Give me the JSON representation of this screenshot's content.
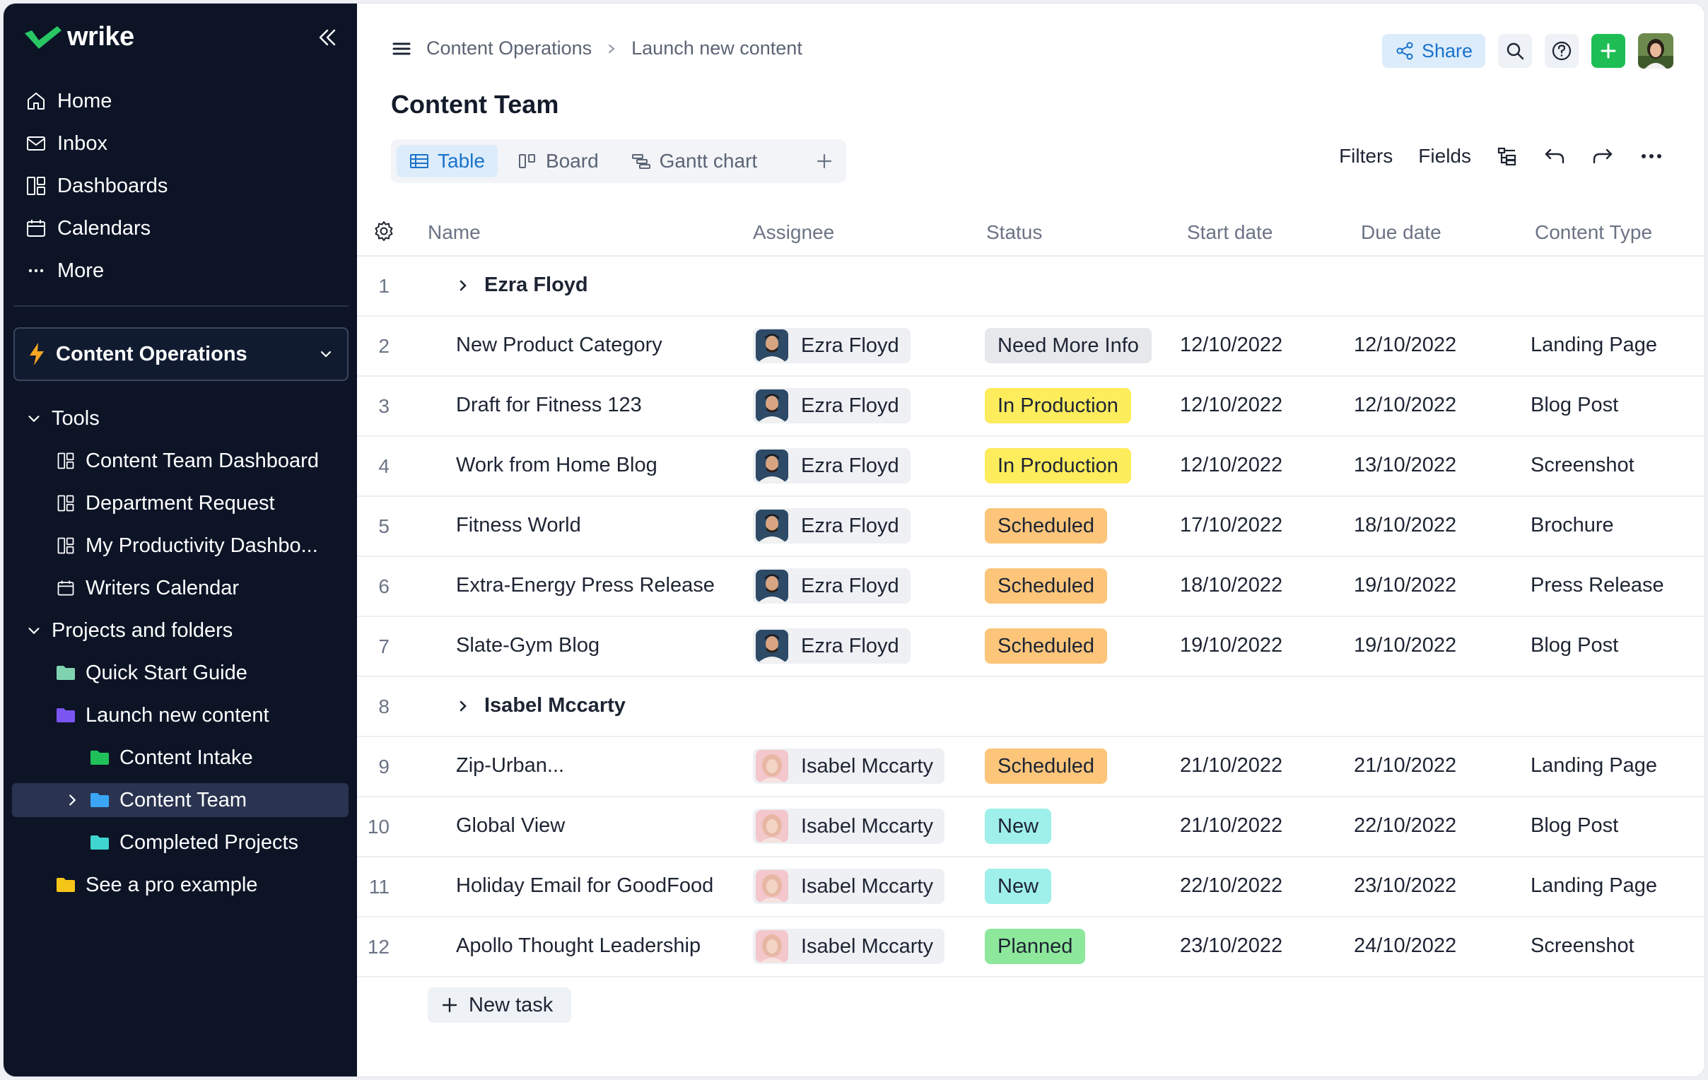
{
  "app": {
    "logo_text": "wrike"
  },
  "sidebar": {
    "nav": [
      {
        "label": "Home",
        "icon": "home-icon"
      },
      {
        "label": "Inbox",
        "icon": "inbox-icon"
      },
      {
        "label": "Dashboards",
        "icon": "dashboards-icon"
      },
      {
        "label": "Calendars",
        "icon": "calendar-icon"
      },
      {
        "label": "More",
        "icon": "more-icon"
      }
    ],
    "space": "Content Operations",
    "tree": {
      "tools": "Tools",
      "tool_items": [
        "Content Team Dashboard",
        "Department Request",
        "My Productivity Dashbo...",
        "Writers Calendar"
      ],
      "projects": "Projects and folders",
      "folders": [
        "Quick Start Guide",
        "Launch new content",
        "Content Intake",
        "Content Team",
        "Completed Projects",
        "See a pro example"
      ]
    }
  },
  "breadcrumb": {
    "parent": "Content Operations",
    "current": "Launch new content"
  },
  "page_title": "Content Team",
  "top_actions": {
    "share": "Share"
  },
  "views": {
    "tabs": [
      "Table",
      "Board",
      "Gantt chart"
    ],
    "active": "Table"
  },
  "toolbar": {
    "filters": "Filters",
    "fields": "Fields"
  },
  "table": {
    "columns": [
      "Name",
      "Assignee",
      "Status",
      "Start date",
      "Due date",
      "Content Type"
    ],
    "rows": [
      {
        "num": "1",
        "group": "Ezra Floyd"
      },
      {
        "num": "2",
        "name": "New Product Category",
        "assignee": "Ezra Floyd",
        "status": "Need More Info",
        "start": "12/10/2022",
        "due": "12/10/2022",
        "type": "Landing Page"
      },
      {
        "num": "3",
        "name": "Draft for Fitness 123",
        "assignee": "Ezra Floyd",
        "status": "In Production",
        "start": "12/10/2022",
        "due": "12/10/2022",
        "type": "Blog Post"
      },
      {
        "num": "4",
        "name": "Work from Home Blog",
        "assignee": "Ezra Floyd",
        "status": "In Production",
        "start": "12/10/2022",
        "due": "13/10/2022",
        "type": "Screenshot"
      },
      {
        "num": "5",
        "name": "Fitness World",
        "assignee": "Ezra Floyd",
        "status": "Scheduled",
        "start": "17/10/2022",
        "due": "18/10/2022",
        "type": "Brochure"
      },
      {
        "num": "6",
        "name": "Extra-Energy Press Release",
        "assignee": "Ezra Floyd",
        "status": "Scheduled",
        "start": "18/10/2022",
        "due": "19/10/2022",
        "type": "Press Release"
      },
      {
        "num": "7",
        "name": "Slate-Gym Blog",
        "assignee": "Ezra Floyd",
        "status": "Scheduled",
        "start": "19/10/2022",
        "due": "19/10/2022",
        "type": "Blog Post"
      },
      {
        "num": "8",
        "group": "Isabel Mccarty"
      },
      {
        "num": "9",
        "name": "Zip-Urban...",
        "assignee": "Isabel Mccarty",
        "status": "Scheduled",
        "start": "21/10/2022",
        "due": "21/10/2022",
        "type": "Landing Page"
      },
      {
        "num": "10",
        "name": "Global View",
        "assignee": "Isabel Mccarty",
        "status": "New",
        "start": "21/10/2022",
        "due": "22/10/2022",
        "type": "Blog Post"
      },
      {
        "num": "11",
        "name": "Holiday Email for GoodFood",
        "assignee": "Isabel Mccarty",
        "status": "New",
        "start": "22/10/2022",
        "due": "23/10/2022",
        "type": "Landing Page"
      },
      {
        "num": "12",
        "name": "Apollo Thought Leadership",
        "assignee": "Isabel Mccarty",
        "status": "Planned",
        "start": "23/10/2022",
        "due": "24/10/2022",
        "type": "Screenshot"
      }
    ]
  },
  "status_colors": {
    "Need More Info": {
      "bg": "#e6e8ec",
      "fg": "#1d2433"
    },
    "In Production": {
      "bg": "#fdec5c",
      "fg": "#1d2433"
    },
    "Scheduled": {
      "bg": "#fcc57a",
      "fg": "#1d2433"
    },
    "New": {
      "bg": "#9ff0ea",
      "fg": "#1d2433"
    },
    "Planned": {
      "bg": "#8ee89b",
      "fg": "#1d2433"
    }
  },
  "new_task": "New task",
  "colors": {
    "sidebar_bg": "#0c1426",
    "accent": "#1a73c9",
    "brand_green": "#1fbe55"
  }
}
